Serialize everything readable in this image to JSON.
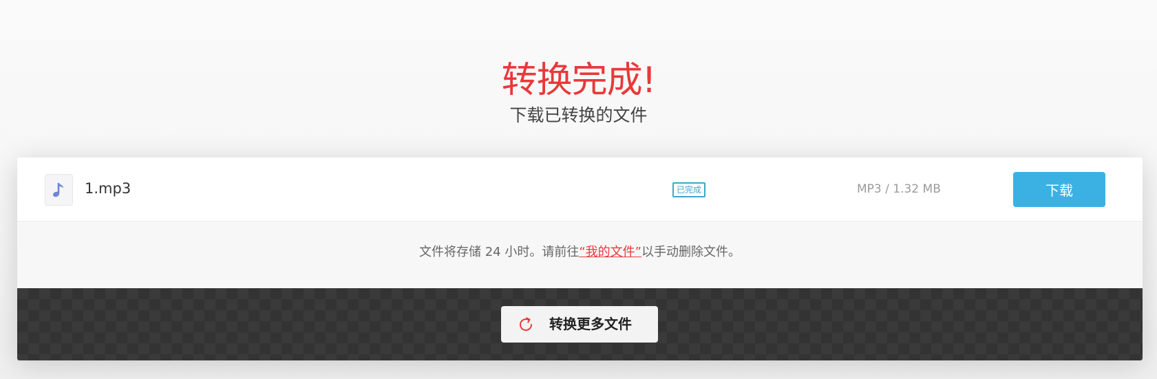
{
  "heading": {
    "title": "转换完成!",
    "subtitle": "下载已转换的文件"
  },
  "file": {
    "icon": "music-note-icon",
    "name": "1.mp3",
    "status": "已完成",
    "meta": "MP3 / 1.32 MB",
    "download_label": "下载"
  },
  "note": {
    "before": "文件将存储 24 小时。请前往",
    "link": "“我的文件”",
    "after": "以手动删除文件。"
  },
  "footer": {
    "convert_more_label": "转换更多文件",
    "icon": "refresh-icon"
  },
  "colors": {
    "accent_red": "#e8393a",
    "download_blue": "#3bb1e3",
    "status_teal": "#3aa7c9"
  }
}
